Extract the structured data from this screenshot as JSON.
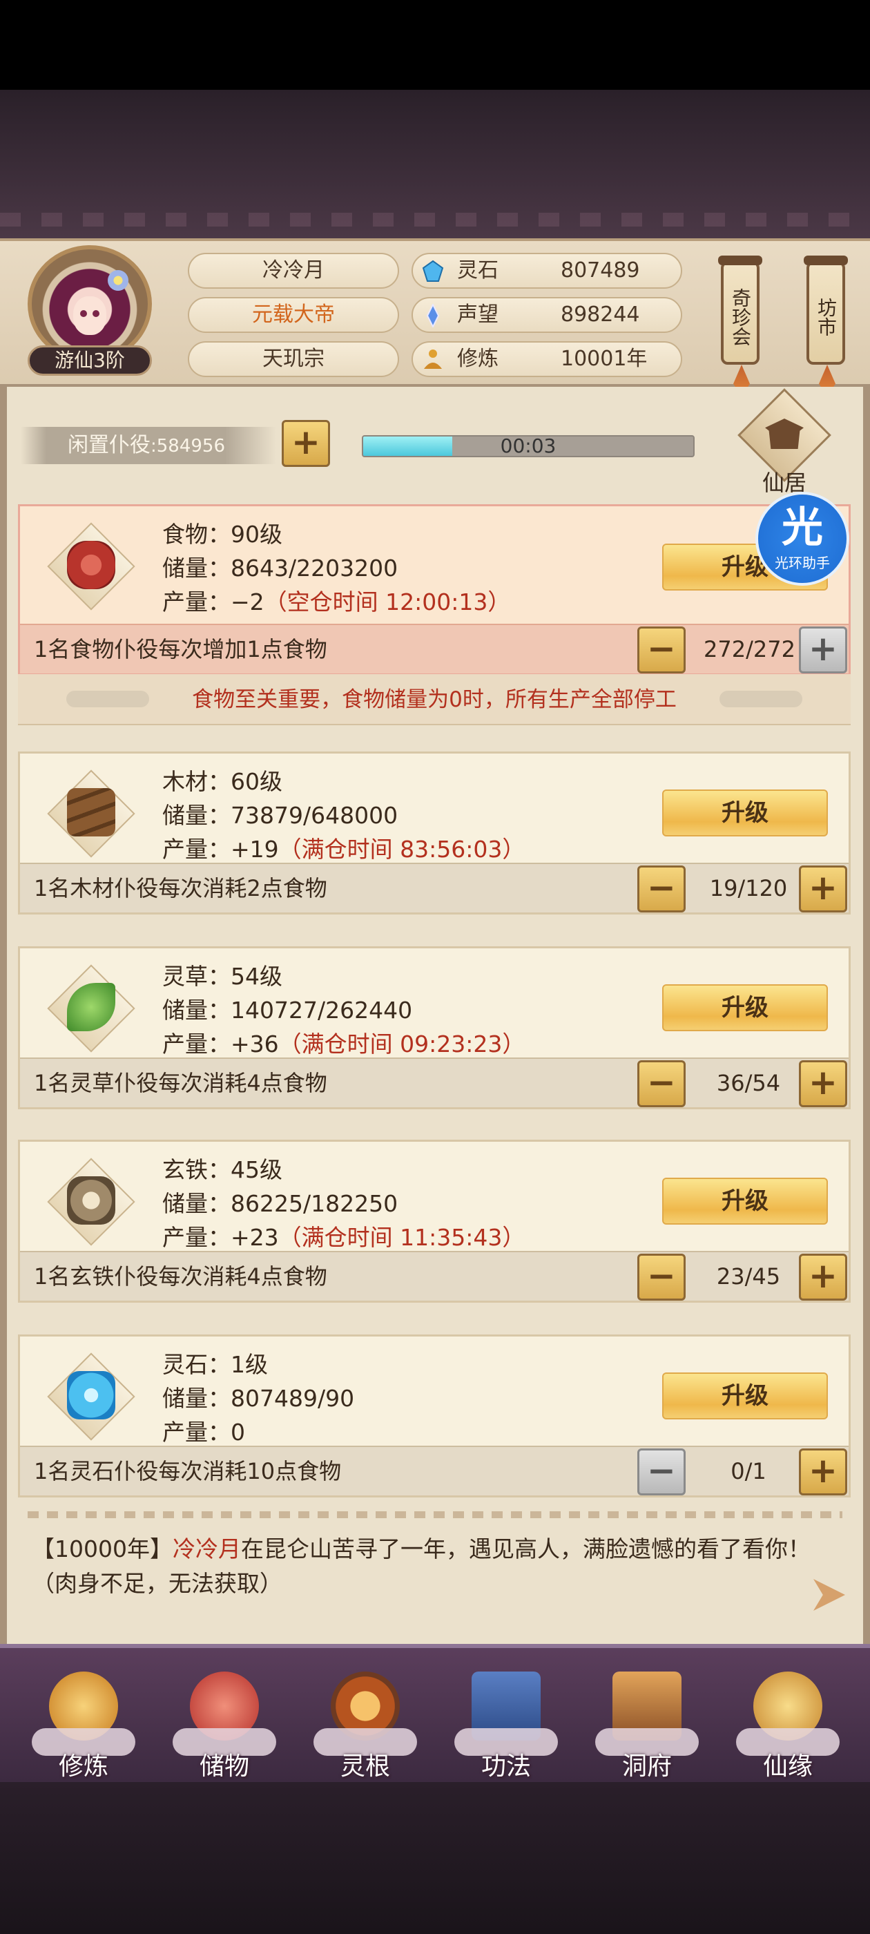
{
  "player": {
    "name": "冷冷月",
    "title": "元载大帝",
    "sect": "天玑宗",
    "rank": "游仙3阶"
  },
  "resources": [
    {
      "icon": "spirit-stone-icon",
      "label": "灵石",
      "value": "807489"
    },
    {
      "icon": "reputation-icon",
      "label": "声望",
      "value": "898244"
    },
    {
      "icon": "cultivation-icon",
      "label": "修炼",
      "value": "10001年"
    }
  ],
  "side_buttons": {
    "treasure": "奇珍会",
    "market": "坊市"
  },
  "idle": {
    "label": "闲置仆役",
    "count": ":584956",
    "timer": "00:03",
    "progress": 0.27
  },
  "residence_label": "仙居",
  "halo": {
    "big": "光",
    "small": "光环助手"
  },
  "buildings": [
    {
      "name": "food",
      "icon": "meat-icon",
      "level_line": "食物：90级",
      "storage_line": "储量：8643/2203200",
      "output_prefix": "产量：−2",
      "output_note": "（空仓时间 12:00:13）",
      "upgrade": "升级",
      "desc": "1名食物仆役每次增加1点食物",
      "count": "272/272"
    },
    {
      "name": "wood",
      "icon": "wood-icon",
      "level_line": "木材：60级",
      "storage_line": "储量：73879/648000",
      "output_prefix": "产量：+19",
      "output_note": "（满仓时间 83:56:03）",
      "upgrade": "升级",
      "desc": "1名木材仆役每次消耗2点食物",
      "count": "19/120"
    },
    {
      "name": "herb",
      "icon": "herb-icon",
      "level_line": "灵草：54级",
      "storage_line": "储量：140727/262440",
      "output_prefix": "产量：+36",
      "output_note": "（满仓时间 09:23:23）",
      "upgrade": "升级",
      "desc": "1名灵草仆役每次消耗4点食物",
      "count": "36/54"
    },
    {
      "name": "iron",
      "icon": "iron-ore-icon",
      "level_line": "玄铁：45级",
      "storage_line": "储量：86225/182250",
      "output_prefix": "产量：+23",
      "output_note": "（满仓时间 11:35:43）",
      "upgrade": "升级",
      "desc": "1名玄铁仆役每次消耗4点食物",
      "count": "23/45"
    },
    {
      "name": "stone",
      "icon": "crystal-icon",
      "level_line": "灵石：1级",
      "storage_line": "储量：807489/90",
      "output_prefix": "产量：0",
      "output_note": "",
      "upgrade": "升级",
      "desc": "1名灵石仆役每次消耗10点食物",
      "count": "0/1"
    }
  ],
  "warning": "食物至关重要，食物储量为0时，所有生产全部停工",
  "log": {
    "year": "【10000年】",
    "name": "冷冷月",
    "text": "在昆仑山苦寻了一年，遇见高人，满脸遗憾的看了看你！（肉身不足，无法获取）"
  },
  "nav": [
    {
      "label": "修炼",
      "icon": "cultivate-icon",
      "color": "#e0a030"
    },
    {
      "label": "储物",
      "icon": "bag-icon",
      "color": "#d8473f"
    },
    {
      "label": "灵根",
      "icon": "spirit-root-icon",
      "color": "#c9782c"
    },
    {
      "label": "功法",
      "icon": "book-icon",
      "color": "#3c5e9e"
    },
    {
      "label": "洞府",
      "icon": "cave-house-icon",
      "color": "#b5793c"
    },
    {
      "label": "仙缘",
      "icon": "gourd-icon",
      "color": "#d9a23a"
    }
  ],
  "colors": {
    "accent_red": "#b3301e",
    "title_orange": "#d2651c",
    "upgrade_gold": "#efb84b"
  }
}
